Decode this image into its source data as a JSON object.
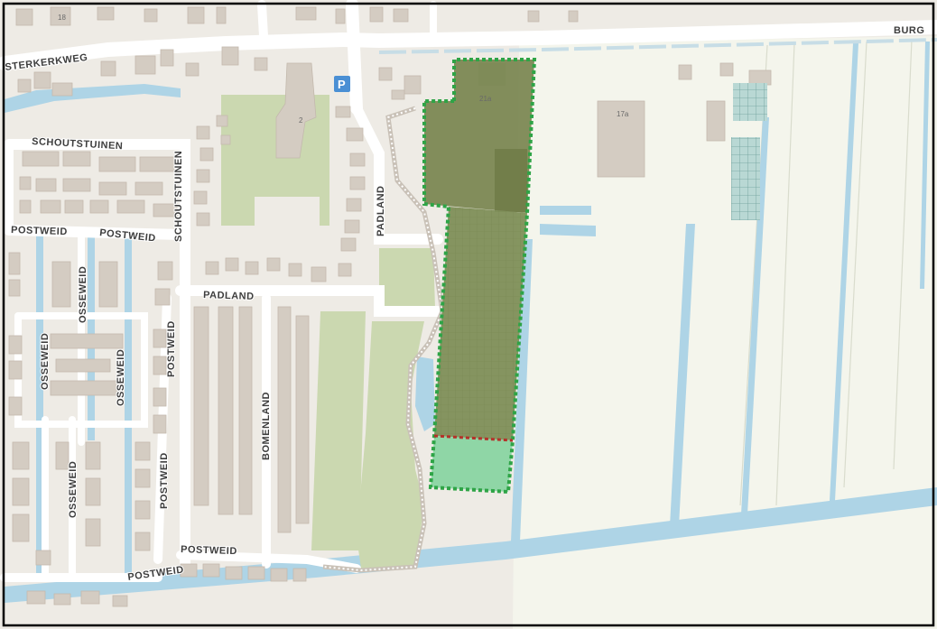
{
  "map": {
    "streets": {
      "kerkweg": "STERKERKWEG",
      "burg": "BURG",
      "schoutstuinen_h": "SCHOUTSTUINEN",
      "schoutstuinen_v": "SCHOUTSTUINEN",
      "postweid_w": "POSTWEID",
      "postweid_c": "POSTWEID",
      "padland_v": "PADLAND",
      "padland_h": "PADLAND",
      "osseweid_1": "OSSEWEID",
      "osseweid_2": "OSSEWEID",
      "osseweid_3": "OSSEWEID",
      "osseweid_4": "OSSEWEID",
      "postweid_v1": "POSTWEID",
      "postweid_v2": "POSTWEID",
      "bomenland": "BOMENLAND",
      "postweid_s": "POSTWEID",
      "postweid_sw": "POSTWEID"
    },
    "house_numbers": {
      "n18": "18",
      "n2": "2",
      "n21a": "21a",
      "n17a": "17a"
    },
    "poi": {
      "parking": "P"
    },
    "colors": {
      "land": "#eeebe5",
      "polder": "#f4f5ec",
      "water": "#aed4e6",
      "road": "#ffffff",
      "building": "#d4ccc2",
      "green": "#cbd8b0",
      "plan_dark": "#78844f",
      "plan_mid": "#7e8f58",
      "plan_light": "#8fd6a6",
      "border_green": "#2ea446",
      "border_red": "#b4322a"
    }
  }
}
